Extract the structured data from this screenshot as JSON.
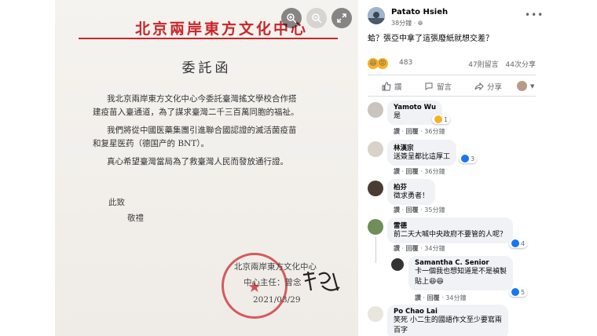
{
  "document": {
    "org_title": "北京兩岸東方文化中心",
    "heading": "委託函",
    "paragraph1_line1": "我北京兩岸東方文化中心今委託臺灣搖文學校合作搭",
    "paragraph1_line2": "建疫苗入臺通道，為了謀求臺灣二千三百萬同胞的福祉。",
    "paragraph2_line1": "我們將從中國医藥集團引進聯合國認證的滅活菌疫苗",
    "paragraph2_line2": "和复星医药（德国产的 BNT）。",
    "paragraph3_line1": "真心希望臺灣當局為了救臺灣人民而發放通行證。",
    "closing1": "此致",
    "closing2": "敬禮",
    "sign_org": "北京兩岸東方文化中心",
    "sign_person": "中心主任：曾念",
    "signature": "曾念",
    "date": "2021/03/29"
  },
  "post": {
    "author": "Patato Hsieh",
    "time": "38分鐘 · ",
    "text": "蛤？張亞中拿了這張廢紙就想交差？",
    "reaction_count": "483",
    "comments_count": "47則留言",
    "shares_count": "44次分享",
    "actions": {
      "like": "讚",
      "comment": "留言",
      "share": "分享"
    }
  },
  "comments": [
    {
      "name": "Yamoto Wu",
      "text": "是",
      "like": "讚",
      "reply": "回覆",
      "time": "36分鐘",
      "reactions": "1"
    },
    {
      "name": "林漢宗",
      "text": "送簽呈都比這厚工",
      "like": "讚",
      "reply": "回覆",
      "time": "36分鐘",
      "reactions": "3"
    },
    {
      "name": "柏芬",
      "text": "徵求勇者！",
      "like": "讚",
      "reply": "回覆",
      "time": "35分鐘"
    },
    {
      "name": "雷德",
      "text": "前二天大喊中央政府不要管的人呢？",
      "like": "讚",
      "reply": "回覆",
      "time": "34分鐘",
      "reactions": "4"
    },
    {
      "name": "Samantha C. Senior",
      "text_line1": "卡一個我也想知道是不是禎製",
      "text_line2": "貼上",
      "like": "讚",
      "reply": "回覆",
      "time": "34分鐘",
      "reactions": "5"
    },
    {
      "name": "Po Chao Lai",
      "text_line1": "笑死 小二生的國語作文至少要寫兩",
      "text_line2": "百字"
    }
  ],
  "colors": {
    "fb_blue": "#1877f2",
    "seal_red": "#c8262a"
  },
  "icons": [
    "zoom-in-icon",
    "zoom-out-icon",
    "fullscreen-icon",
    "more-icon",
    "like-icon",
    "comment-icon",
    "share-icon"
  ]
}
